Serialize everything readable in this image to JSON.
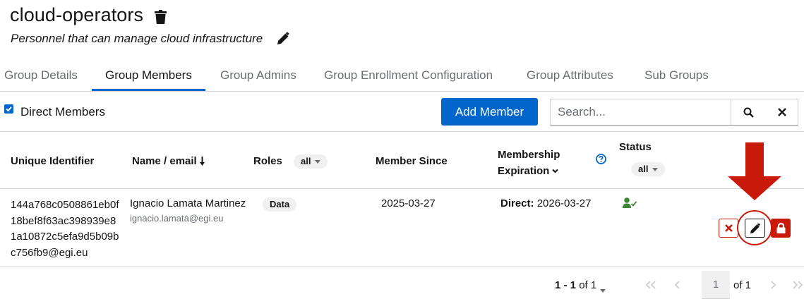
{
  "header": {
    "title": "cloud-operators",
    "description": "Personnel that can manage cloud infrastructure"
  },
  "tabs": [
    {
      "label": "Group Details"
    },
    {
      "label": "Group Members",
      "active": true
    },
    {
      "label": "Group Admins"
    },
    {
      "label": "Group Enrollment Configuration"
    },
    {
      "label": "Group Attributes"
    },
    {
      "label": "Sub Groups"
    }
  ],
  "toolbar": {
    "direct_members_label": "Direct Members",
    "direct_members_checked": true,
    "add_member_label": "Add Member",
    "search_placeholder": "Search..."
  },
  "table": {
    "columns": {
      "uid": "Unique Identifier",
      "name": "Name / email",
      "roles": "Roles",
      "roles_filter": "all",
      "member_since": "Member Since",
      "expiration_line1": "Membership",
      "expiration_line2": "Expiration",
      "status": "Status",
      "status_filter": "all"
    },
    "rows": [
      {
        "uid": "144a768c0508861eb0f18bef8f63ac398939e81a10872c5efa9d5b09bc756fb9@egi.eu",
        "name": "Ignacio Lamata Martinez",
        "email": "ignacio.lamata@egi.eu",
        "role": "Data",
        "member_since": "2025-03-27",
        "expiration_prefix": "Direct:",
        "expiration_date": "2026-03-27",
        "status_icon": "user-check-icon"
      }
    ]
  },
  "pagination": {
    "range": "1 - 1",
    "of_total": "of 1",
    "page": "1",
    "page_of": "of 1"
  },
  "colors": {
    "primary": "#0066cc",
    "danger": "#c9190b",
    "success": "#3e8635"
  }
}
